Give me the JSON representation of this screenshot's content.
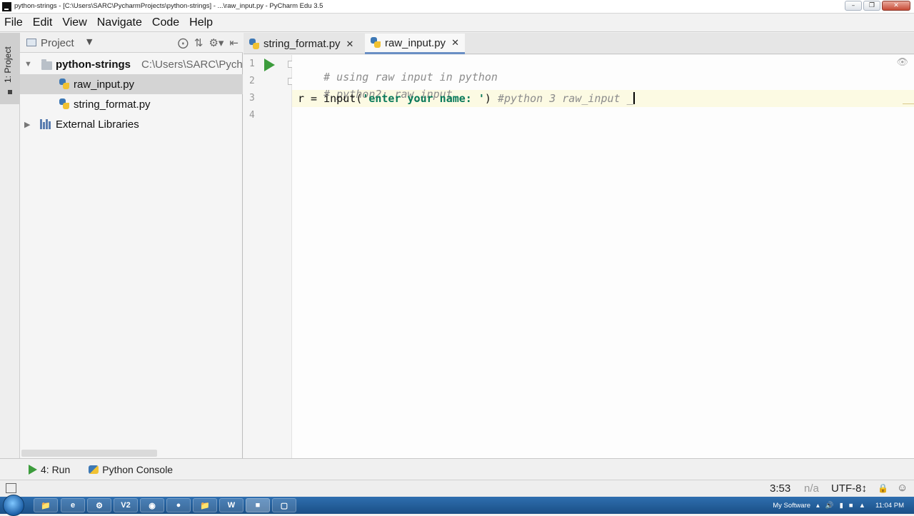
{
  "window": {
    "title": "python-strings - [C:\\Users\\SARC\\PycharmProjects\\python-strings] - ...\\raw_input.py - PyCharm Edu 3.5"
  },
  "menu": [
    "File",
    "Edit",
    "View",
    "Navigate",
    "Code",
    "Help"
  ],
  "left_strip": {
    "project_tab": "1: Project"
  },
  "project_panel": {
    "header": "Project",
    "tree": [
      {
        "name": "python-strings",
        "path": "C:\\Users\\SARC\\Pycha"
      },
      {
        "name": "raw_input.py"
      },
      {
        "name": "string_format.py"
      },
      {
        "name": "External Libraries"
      }
    ]
  },
  "tabs": [
    {
      "label": "string_format.py"
    },
    {
      "label": "raw_input.py"
    }
  ],
  "editor": {
    "line_numbers": [
      "1",
      "2",
      "3",
      "4"
    ],
    "lines": [
      {
        "comment": "# using raw input in python"
      },
      {
        "comment": "# python2: raw_input"
      },
      {
        "var": "r = input(",
        "string": "'enter your name: '",
        "close": ") ",
        "comment": "#python 3 raw_input _"
      },
      {}
    ]
  },
  "bottom_tabs": [
    {
      "label": "4: Run"
    },
    {
      "label": "Python Console"
    }
  ],
  "status": {
    "position": "3:53",
    "na": "n/a",
    "encoding": "UTF-8↕"
  },
  "taskbar": {
    "tray_label": "My Software",
    "clock": "11:04 PM",
    "apps": [
      "",
      "",
      "",
      "V2",
      "",
      "",
      "",
      "W",
      "",
      ""
    ]
  },
  "colors": {
    "string": "#0a7a5a",
    "comment": "#8c8c8c",
    "run_green": "#3c9c3c",
    "tab_underline": "#6a8fc4"
  }
}
